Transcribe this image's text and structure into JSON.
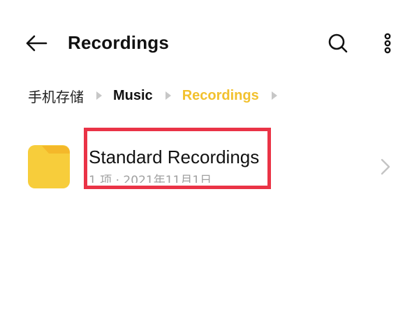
{
  "header": {
    "title": "Recordings",
    "back_icon": "arrow-left-icon",
    "search_icon": "search-icon",
    "more_icon": "more-vertical-icon"
  },
  "breadcrumb": {
    "items": [
      {
        "label": "手机存储"
      },
      {
        "label": "Music"
      },
      {
        "label": "Recordings"
      }
    ],
    "active_color": "#f2c12e",
    "separator_icon": "chevron-right-icon"
  },
  "folders": [
    {
      "name": "Standard Recordings",
      "meta": "1 项 · 2021年11月1日",
      "icon": "folder-icon",
      "icon_color": "#f7cd3b"
    }
  ],
  "annotation": {
    "color": "#ea3346"
  }
}
